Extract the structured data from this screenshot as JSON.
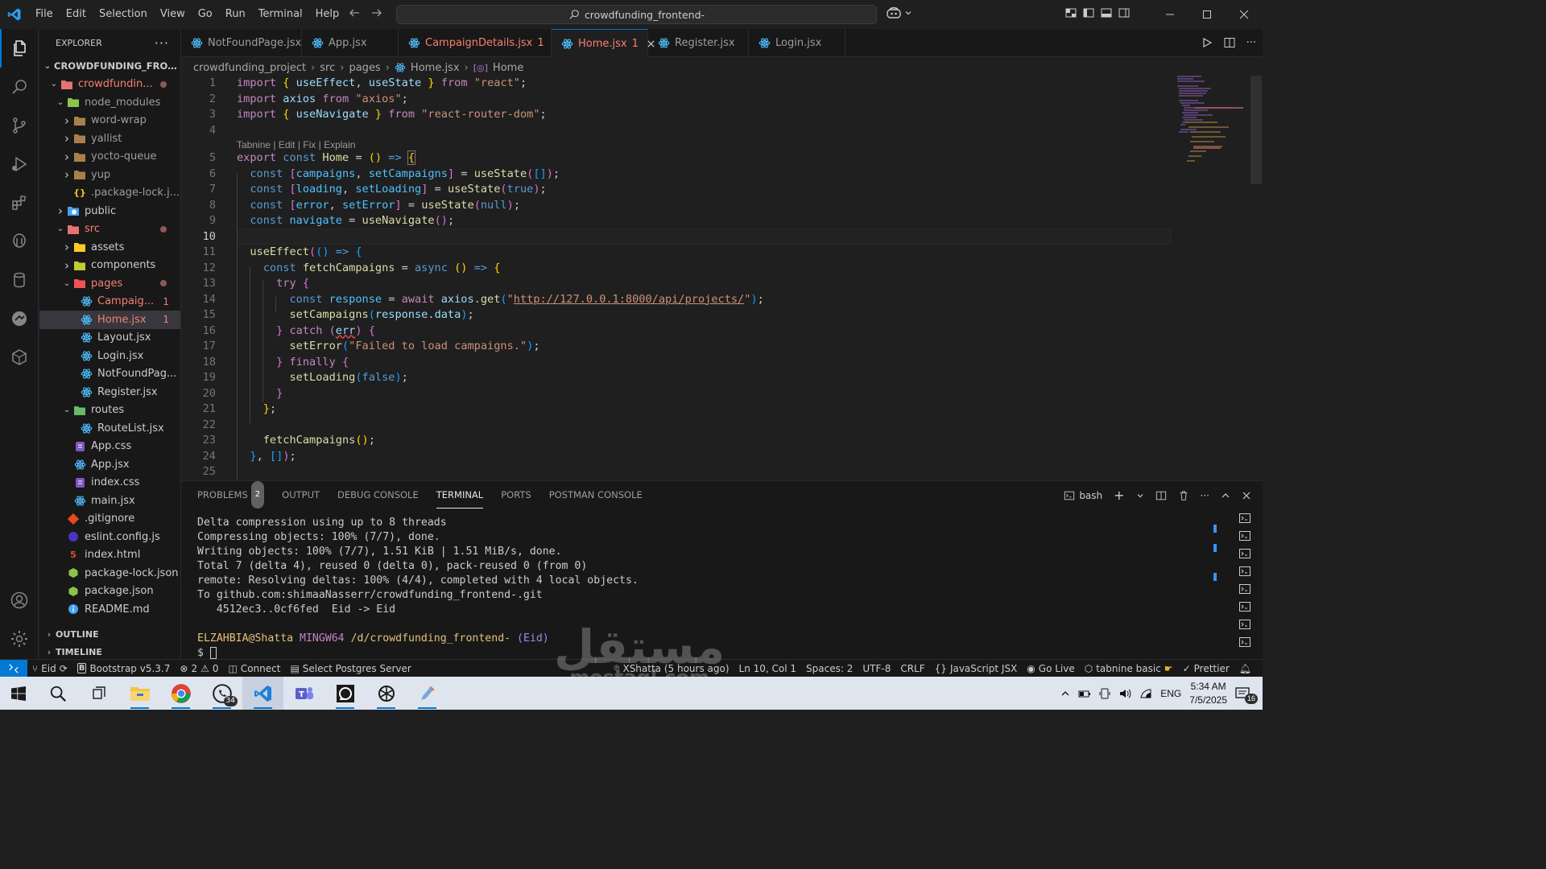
{
  "app": {
    "title": "crowdfunding_frontend-",
    "menu": [
      "File",
      "Edit",
      "Selection",
      "View",
      "Go",
      "Run",
      "Terminal",
      "Help"
    ]
  },
  "sidebar": {
    "header": "EXPLORER",
    "root": "CROWDFUNDING_FRONTE...",
    "tree": [
      {
        "label": "crowdfundin...",
        "indent": 1,
        "chev": "v",
        "icon": "folder-src",
        "color": "#f88070",
        "dot": true
      },
      {
        "label": "node_modules",
        "indent": 2,
        "chev": "v",
        "icon": "folder-node",
        "color": "#9d9d9d"
      },
      {
        "label": "word-wrap",
        "indent": 3,
        "chev": ">",
        "icon": "folder",
        "color": "#9d9d9d"
      },
      {
        "label": "yallist",
        "indent": 3,
        "chev": ">",
        "icon": "folder",
        "color": "#9d9d9d"
      },
      {
        "label": "yocto-queue",
        "indent": 3,
        "chev": ">",
        "icon": "folder",
        "color": "#9d9d9d"
      },
      {
        "label": "yup",
        "indent": 3,
        "chev": ">",
        "icon": "folder",
        "color": "#9d9d9d"
      },
      {
        "label": ".package-lock.j...",
        "indent": 3,
        "chev": "",
        "icon": "json",
        "color": "#9d9d9d"
      },
      {
        "label": "public",
        "indent": 2,
        "chev": ">",
        "icon": "folder-public",
        "color": "#cccccc"
      },
      {
        "label": "src",
        "indent": 2,
        "chev": "v",
        "icon": "folder-src",
        "color": "#f88070",
        "dot": true
      },
      {
        "label": "assets",
        "indent": 3,
        "chev": ">",
        "icon": "folder-assets",
        "color": "#cccccc"
      },
      {
        "label": "components",
        "indent": 3,
        "chev": ">",
        "icon": "folder-components",
        "color": "#cccccc"
      },
      {
        "label": "pages",
        "indent": 3,
        "chev": "v",
        "icon": "folder-pages",
        "color": "#f88070",
        "dot": true
      },
      {
        "label": "Campaig...",
        "indent": 4,
        "chev": "",
        "icon": "react",
        "color": "#f88070",
        "badge": "1"
      },
      {
        "label": "Home.jsx",
        "indent": 4,
        "chev": "",
        "icon": "react",
        "color": "#f88070",
        "badge": "1",
        "selected": true
      },
      {
        "label": "Layout.jsx",
        "indent": 4,
        "chev": "",
        "icon": "react",
        "color": "#cccccc"
      },
      {
        "label": "Login.jsx",
        "indent": 4,
        "chev": "",
        "icon": "react",
        "color": "#cccccc"
      },
      {
        "label": "NotFoundPag...",
        "indent": 4,
        "chev": "",
        "icon": "react",
        "color": "#cccccc"
      },
      {
        "label": "Register.jsx",
        "indent": 4,
        "chev": "",
        "icon": "react",
        "color": "#cccccc"
      },
      {
        "label": "routes",
        "indent": 3,
        "chev": "v",
        "icon": "folder-routes",
        "color": "#cccccc"
      },
      {
        "label": "RouteList.jsx",
        "indent": 4,
        "chev": "",
        "icon": "react",
        "color": "#cccccc"
      },
      {
        "label": "App.css",
        "indent": 3,
        "chev": "",
        "icon": "css",
        "color": "#cccccc"
      },
      {
        "label": "App.jsx",
        "indent": 3,
        "chev": "",
        "icon": "react",
        "color": "#cccccc"
      },
      {
        "label": "index.css",
        "indent": 3,
        "chev": "",
        "icon": "css",
        "color": "#cccccc"
      },
      {
        "label": "main.jsx",
        "indent": 3,
        "chev": "",
        "icon": "react",
        "color": "#cccccc"
      },
      {
        "label": ".gitignore",
        "indent": 2,
        "chev": "",
        "icon": "git",
        "color": "#cccccc"
      },
      {
        "label": "eslint.config.js",
        "indent": 2,
        "chev": "",
        "icon": "eslint",
        "color": "#cccccc"
      },
      {
        "label": "index.html",
        "indent": 2,
        "chev": "",
        "icon": "html",
        "color": "#cccccc"
      },
      {
        "label": "package-lock.json",
        "indent": 2,
        "chev": "",
        "icon": "npm",
        "color": "#cccccc"
      },
      {
        "label": "package.json",
        "indent": 2,
        "chev": "",
        "icon": "npm",
        "color": "#cccccc"
      },
      {
        "label": "README.md",
        "indent": 2,
        "chev": "",
        "icon": "info",
        "color": "#cccccc"
      }
    ],
    "outline": "OUTLINE",
    "timeline": "TIMELINE"
  },
  "tabs": [
    {
      "label": "NotFoundPage.jsx",
      "state": "normal"
    },
    {
      "label": "App.jsx",
      "state": "normal"
    },
    {
      "label": "CampaignDetails.jsx",
      "badge": "1",
      "state": "error"
    },
    {
      "label": "Home.jsx",
      "badge": "1",
      "state": "active"
    },
    {
      "label": "Register.jsx",
      "state": "normal"
    },
    {
      "label": "Login.jsx",
      "state": "normal"
    }
  ],
  "breadcrumb": [
    "crowdfunding_project",
    "src",
    "pages",
    "Home.jsx",
    "Home"
  ],
  "editor": {
    "tabnine": "Tabnine | Edit | Fix | Explain",
    "url": "http://127.0.0.1:8000/api/projects/"
  },
  "panel": {
    "tabs": [
      "PROBLEMS",
      "OUTPUT",
      "DEBUG CONSOLE",
      "TERMINAL",
      "PORTS",
      "POSTMAN CONSOLE"
    ],
    "problems_count": "2",
    "shell": "bash",
    "terminal_lines": [
      "Delta compression using up to 8 threads",
      "Compressing objects: 100% (7/7), done.",
      "Writing objects: 100% (7/7), 1.51 KiB | 1.51 MiB/s, done.",
      "Total 7 (delta 4), reused 0 (delta 0), pack-reused 0 (from 0)",
      "remote: Resolving deltas: 100% (4/4), completed with 4 local objects.",
      "To github.com:shimaaNasserr/crowdfunding_frontend-.git",
      "   4512ec3..0cf6fed  Eid -> Eid"
    ],
    "prompt_user": "ELZAHBIA@Shatta",
    "prompt_env": "MINGW64",
    "prompt_path": "/d/crowdfunding_frontend-",
    "prompt_branch": "(Eid)",
    "prompt_symbol": "$"
  },
  "status": {
    "branch": "Eid",
    "bootstrap": "Bootstrap v5.3.7",
    "errors": "2",
    "warnings": "0",
    "connect": "Connect",
    "postgres": "Select Postgres Server",
    "blame": "XShatta (5 hours ago)",
    "position": "Ln 10, Col 1",
    "spaces": "Spaces: 2",
    "encoding": "UTF-8",
    "eol": "CRLF",
    "language": "JavaScript JSX",
    "golive": "Go Live",
    "tabnine": "tabnine basic",
    "prettier": "Prettier"
  },
  "taskbar": {
    "time": "5:34 AM",
    "date": "7/5/2025",
    "lang": "ENG",
    "whatsapp_badge": "34",
    "notif_badge": "16"
  },
  "watermark": {
    "arabic": "مستقل",
    "latin": "mostaql.com"
  },
  "colors": {
    "accent": "#0078d4",
    "error": "#f88070",
    "bg": "#1f1f1f",
    "sidebar": "#181818"
  }
}
